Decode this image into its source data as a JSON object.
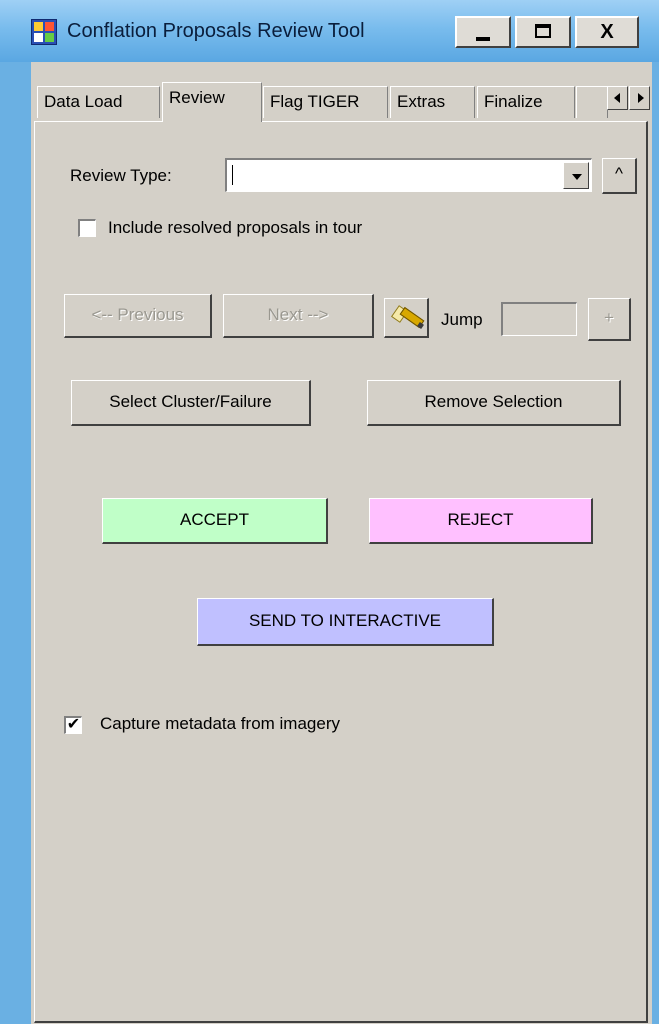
{
  "window": {
    "title": "Conflation Proposals Review Tool",
    "minimize_label": "_",
    "close_label": "X"
  },
  "tabs": [
    {
      "label": "Data Load",
      "active": false
    },
    {
      "label": "Review",
      "active": true
    },
    {
      "label": "Flag TIGER",
      "active": false
    },
    {
      "label": "Extras",
      "active": false
    },
    {
      "label": "Finalize",
      "active": false
    }
  ],
  "review": {
    "review_type_label": "Review Type:",
    "review_type_value": "",
    "caret_button_label": "^",
    "include_resolved_label": "Include resolved proposals in tour",
    "include_resolved_checked": false,
    "previous_label": "<-- Previous",
    "next_label": "Next -->",
    "jump_label": "Jump",
    "jump_value": "",
    "plus_label": "+",
    "select_cluster_label": "Select Cluster/Failure",
    "remove_selection_label": "Remove Selection",
    "accept_label": "ACCEPT",
    "reject_label": "REJECT",
    "send_label": "SEND TO INTERACTIVE",
    "capture_label": "Capture metadata from imagery",
    "capture_checked": true,
    "check_mark": "✔"
  },
  "colors": {
    "accept": "#c0ffc8",
    "reject": "#ffc0ff",
    "send": "#c0c0ff",
    "panel": "#d4d0c8"
  },
  "icons": {
    "app": "app-icon",
    "flashlight": "flashlight-icon"
  }
}
